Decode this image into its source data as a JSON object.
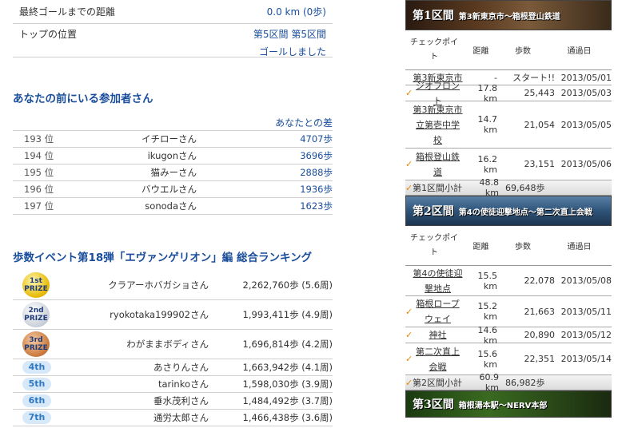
{
  "summary": {
    "goal_label": "最終ゴールまでの距離",
    "goal_value": "0.0 km (0歩)",
    "top_label": "トップの位置",
    "top_value_1": "第5区間 第5区間",
    "top_value_2": "ゴールしました"
  },
  "ahead": {
    "title": "あなたの前にいる参加者さん",
    "diff_header": "あなたとの差",
    "rows": [
      {
        "rank": "193 位",
        "name": "イチローさん",
        "diff": "4707歩"
      },
      {
        "rank": "194 位",
        "name": "ikugonさん",
        "diff": "3696歩"
      },
      {
        "rank": "195 位",
        "name": "猫みーさん",
        "diff": "2888歩"
      },
      {
        "rank": "196 位",
        "name": "バウエルさん",
        "diff": "1936歩"
      },
      {
        "rank": "197 位",
        "name": "sonodaさん",
        "diff": "1623歩"
      }
    ]
  },
  "ranking": {
    "title": "歩数イベント第18弾「エヴァンゲリオン」編 総合ランキング",
    "rows": [
      {
        "badge_top": "1st",
        "badge_bottom": "PRIZE",
        "name": "クラアーホバガショさん",
        "steps": "2,262,760歩 (5.6周)"
      },
      {
        "badge_top": "2nd",
        "badge_bottom": "PRIZE",
        "name": "ryokotaka199902さん",
        "steps": "1,993,411歩 (4.9周)"
      },
      {
        "badge_top": "3rd",
        "badge_bottom": "PRIZE",
        "name": "わがままボディさん",
        "steps": "1,696,814歩 (4.2周)"
      },
      {
        "badge": "4th",
        "name": "あさりんさん",
        "steps": "1,663,942歩 (4.1周)"
      },
      {
        "badge": "5th",
        "name": "tarinkoさん",
        "steps": "1,598,030歩 (3.9周)"
      },
      {
        "badge": "6th",
        "name": "垂水茂利さん",
        "steps": "1,484,492歩 (3.7周)"
      },
      {
        "badge": "7th",
        "name": "通労太郎さん",
        "steps": "1,466,438歩 (3.6周)"
      }
    ]
  },
  "sections": [
    {
      "label": "第1区間",
      "route": "第3新東京市～箱根登山鉄道",
      "headers": {
        "checkpoint_1": "チェックポイ",
        "checkpoint_2": "ト",
        "distance": "距離",
        "steps": "歩数",
        "date": "通過日"
      },
      "rows": [
        {
          "check": "",
          "name_1": "第3新東京市",
          "name_2": "",
          "name_3": "",
          "distance": "-",
          "steps": "スタート!!",
          "date": "2013/05/01"
        },
        {
          "check": "✓",
          "name_1": "ジオフロント",
          "name_2": "",
          "name_3": "",
          "distance": "17.8 km",
          "steps": "25,443",
          "date": "2013/05/03"
        },
        {
          "check": "",
          "name_1": "第3新東京市",
          "name_2": "立第壱中学",
          "name_3": "校",
          "distance": "14.7 km",
          "steps": "21,054",
          "date": "2013/05/05"
        },
        {
          "check": "✓",
          "name_1": "箱根登山鉄",
          "name_2": "道",
          "name_3": "",
          "distance": "16.2 km",
          "steps": "23,151",
          "date": "2013/05/06"
        }
      ],
      "subtotal_label": "第1区間小計",
      "subtotal_distance": "48.8 km",
      "subtotal_steps": "69,648歩"
    },
    {
      "label": "第2区間",
      "route": "第4の使徒迎撃地点～第二次直上会戦",
      "headers": {
        "checkpoint_1": "チェックポイ",
        "checkpoint_2": "ト",
        "distance": "距離",
        "steps": "歩数",
        "date": "通過日"
      },
      "rows": [
        {
          "check": "",
          "name_1": "第4の使徒迎",
          "name_2": "撃地点",
          "name_3": "",
          "distance": "15.5 km",
          "steps": "22,078",
          "date": "2013/05/08"
        },
        {
          "check": "✓",
          "name_1": "箱根ロープ",
          "name_2": "ウェイ",
          "name_3": "",
          "distance": "15.2 km",
          "steps": "21,663",
          "date": "2013/05/11"
        },
        {
          "check": "✓",
          "name_1": "神社",
          "name_2": "",
          "name_3": "",
          "distance": "14.6 km",
          "steps": "20,890",
          "date": "2013/05/12"
        },
        {
          "check": "✓",
          "name_1": "第二次直上",
          "name_2": "会戦",
          "name_3": "",
          "distance": "15.6 km",
          "steps": "22,351",
          "date": "2013/05/14"
        }
      ],
      "subtotal_label": "第2区間小計",
      "subtotal_distance": "60.9 km",
      "subtotal_steps": "86,982歩"
    },
    {
      "label": "第3区間",
      "route": "箱根湯本駅～NERV本部"
    }
  ],
  "colors": {
    "link_blue": "#1a4e9c",
    "check_orange": "#e08a00",
    "pill_blue": "#2f78c2"
  }
}
